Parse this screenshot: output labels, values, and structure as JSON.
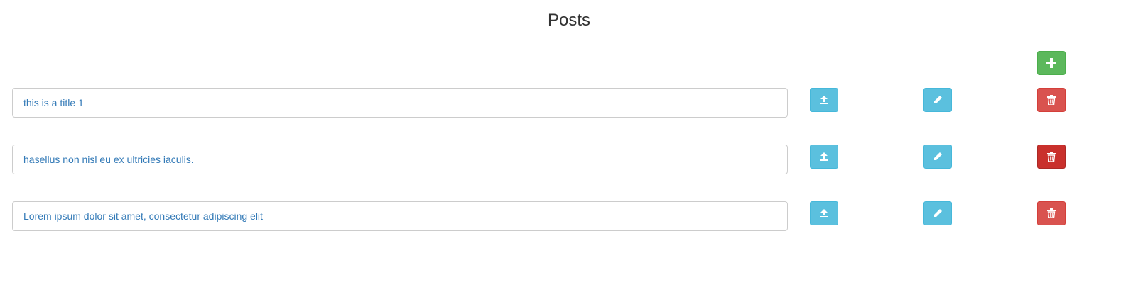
{
  "page": {
    "title": "Posts"
  },
  "toolbar": {
    "add_icon": "plus-icon",
    "add_color": "#5cb85c"
  },
  "posts": [
    {
      "title": "this is a title 1",
      "upload_icon": "upload-icon",
      "edit_icon": "pencil-icon",
      "delete_icon": "trash-icon",
      "delete_active": false
    },
    {
      "title": "hasellus non nisl eu ex ultricies iaculis.",
      "upload_icon": "upload-icon",
      "edit_icon": "pencil-icon",
      "delete_icon": "trash-icon",
      "delete_active": true
    },
    {
      "title": "Lorem ipsum dolor sit amet, consectetur adipiscing elit",
      "upload_icon": "upload-icon",
      "edit_icon": "pencil-icon",
      "delete_icon": "trash-icon",
      "delete_active": false
    }
  ],
  "colors": {
    "info": "#5bc0de",
    "danger": "#d9534f",
    "danger_active": "#c9302c",
    "link": "#337ab7"
  }
}
